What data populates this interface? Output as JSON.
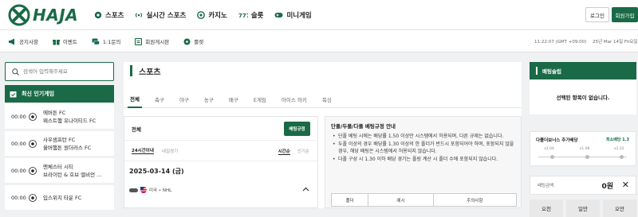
{
  "brand": {
    "name": "HAJA",
    "accent": "#1a6a47"
  },
  "main_nav": [
    {
      "label": "스포츠",
      "icon": "soccer-ball-icon"
    },
    {
      "label": "실시간 스포츠",
      "icon": "live-signal-icon"
    },
    {
      "label": "카지노",
      "icon": "casino-chip-icon"
    },
    {
      "label": "슬롯",
      "icon": "slot-777-icon"
    },
    {
      "label": "미니게임",
      "icon": "gamepad-icon"
    }
  ],
  "auth": {
    "login": "로그인",
    "join": "회원가입"
  },
  "sub_nav": [
    {
      "label": "공지사항",
      "icon": "megaphone-icon"
    },
    {
      "label": "이벤트",
      "icon": "gift-icon"
    },
    {
      "label": "1:1문의",
      "icon": "chat-icon"
    },
    {
      "label": "회원게시판",
      "icon": "board-icon"
    },
    {
      "label": "룰렛",
      "icon": "roulette-icon"
    }
  ],
  "clock": {
    "time": "11:22:07 (GMT +09:00)",
    "date": "25년 Mar 14일 Fri요일"
  },
  "search": {
    "placeholder": "검색어 입력해주세요"
  },
  "popular": {
    "title": "최신 인기게임",
    "games": [
      {
        "time": "00:00",
        "home": "에버튼 FC",
        "away": "웨스트햄 유나이티드 FC"
      },
      {
        "time": "00:00",
        "home": "사우샘프턴 FC",
        "away": "울버햄튼 원더러스 FC"
      },
      {
        "time": "00:00",
        "home": "맨체스터 시티",
        "away": "브라이턴 & 호브 앨비언 ..."
      },
      {
        "time": "00:00",
        "home": "입스위치 타운 FC",
        "away": ""
      }
    ]
  },
  "sports": {
    "title": "스포츠",
    "tabs": [
      "전체",
      "축구",
      "야구",
      "농구",
      "배구",
      "E게임",
      "아이스 하키",
      "복싱"
    ],
    "list_title": "전체",
    "rule_button": "배팅규정",
    "filters": [
      "24시간이내",
      "내일경기"
    ],
    "sorts": [
      "시간순",
      "인기순"
    ],
    "date": "2025-03-14 (금)",
    "league": "미국 • NHL"
  },
  "rules": {
    "title": "단폴/두폴/다폴 베팅규정 안내",
    "items": [
      "단폴 베팅 시에는 배당률 1.50 이상만 시스템에서 허용되며, 다른 규제는 없습니다.",
      "두폴 이상의 경우 배당률 1.30 이상의 한 폴더가 반드시 포함되어야 하며, 포함되지 않을 경우, 해당 배팅은 시스템에서 허용되지 않습니다.",
      "다폴 구성 시 1.30 이하 배당 경기는 폴링 계산 시 폴더 수에 포함되지 않습니다."
    ],
    "table_headers": [
      "폴더",
      "예시",
      "주의사항"
    ]
  },
  "slip": {
    "title": "배팅슬립",
    "empty": "선택된 항목이 없습니다.",
    "bonus_title": "다폴더보너스 추가배당",
    "bonus_min": "최소배당 1.3",
    "bonus_levels": [
      "x1.04",
      "x1.08",
      "x1.12"
    ],
    "amount_label": "배팅금액",
    "amount_value": "0원",
    "amount_clear": "✕",
    "quick": [
      "오천",
      "일만",
      "오만"
    ]
  }
}
